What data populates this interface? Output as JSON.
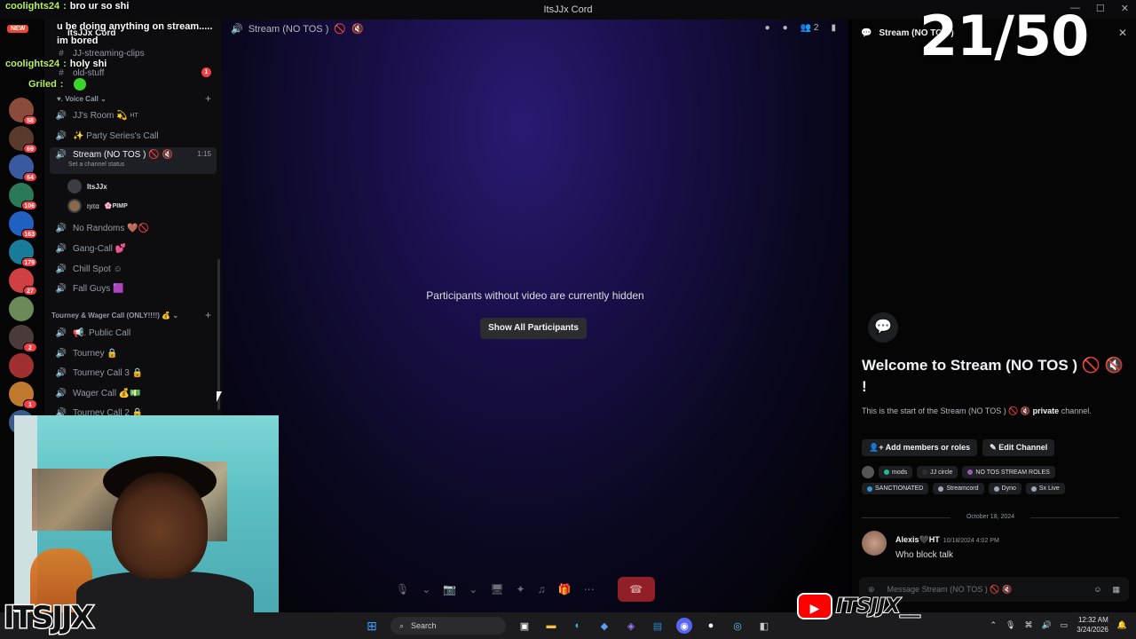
{
  "window": {
    "title": "ItsJJx Cord"
  },
  "chat_overlay": [
    {
      "name": "coolights24",
      "sep": ":",
      "message": "bro ur so shi"
    },
    {
      "name": "",
      "sep": "",
      "message": "u be doing anything on stream....."
    },
    {
      "name": "",
      "sep": "",
      "message": "im bored"
    },
    {
      "name": "coolights24",
      "sep": ":",
      "message": "holy shi"
    },
    {
      "name": "Griled",
      "sep": ":",
      "message": ""
    }
  ],
  "new_tag": "NEW",
  "server": {
    "name": "ItsJJx Cord",
    "badges": [
      "58",
      "69",
      "64",
      "106",
      "163",
      "179",
      "27",
      "2",
      "1"
    ]
  },
  "sidebar": {
    "top_channels": [
      "JJ-streaming-clips",
      "old-stuff"
    ],
    "unread_count": "1",
    "voice_category": "Voice Call",
    "voice_channels": [
      {
        "label": "JJ's Room 💫",
        "suffix": "HT"
      },
      {
        "label": "✨ Party Series's Call",
        "suffix": ""
      }
    ],
    "active_channel": {
      "label": "Stream (NO TOS )",
      "time": "1:15",
      "status": "Set a channel status"
    },
    "voice_users": [
      {
        "name": "ItsJJx",
        "tag": ""
      },
      {
        "name": "ηιτα",
        "tag": "🌸PIMP"
      }
    ],
    "more_channels": [
      {
        "label": "No Randoms 🤎🚫"
      },
      {
        "label": "Gang-Call 💕"
      },
      {
        "label": "Chill Spot ☺"
      },
      {
        "label": "Fall Guys 🟪"
      }
    ],
    "tourney_category": "Tourney & Wager Call (ONLY!!!!) 💰",
    "tourney_channels": [
      {
        "label": "📢. Public Call"
      },
      {
        "label": "Tourney 🔒"
      },
      {
        "label": "Tourney Call 3 🔒"
      },
      {
        "label": "Wager Call 💰💵"
      },
      {
        "label": "Tourney Call 2 🔒"
      }
    ]
  },
  "stage": {
    "channel_title": "Stream (NO TOS )",
    "participant_count": "2",
    "hidden_message": "Participants without video are currently hidden",
    "show_all_label": "Show All Participants"
  },
  "counter": "21/50",
  "panel": {
    "title": "Stream (NO TOS )",
    "welcome": "Welcome to Stream (NO TOS ) 🚫 🔇 !",
    "desc_prefix": "This is the start of the Stream (NO TOS ) 🚫 🔇",
    "desc_private": "private",
    "desc_suffix": "channel.",
    "add_members_label": "Add members or roles",
    "edit_channel_label": "Edit Channel",
    "roles": [
      {
        "name": "mods",
        "color": "#1abc9c"
      },
      {
        "name": "JJ circle",
        "color": "#2b2d31"
      },
      {
        "name": "NO TOS STREAM ROLES",
        "color": "#9b59b6"
      },
      {
        "name": "SANCTIONATED",
        "color": "#3498db"
      },
      {
        "name": "Streamcord",
        "color": "#99aab5"
      },
      {
        "name": "Dyno",
        "color": "#99aab5"
      },
      {
        "name": "Sx Live",
        "color": "#99aab5"
      }
    ],
    "date_separator": "October 18, 2024",
    "message": {
      "author": "Alexis🖤HT",
      "timestamp": "10/18/2024 4:02 PM",
      "text": "Who block talk"
    },
    "composer_placeholder": "Message Stream (NO TOS ) 🚫 🔇"
  },
  "taskbar": {
    "search_label": "Search",
    "time": "12:32 AM",
    "date": "3/24/2026"
  },
  "logos": {
    "left": "ITSJJX",
    "right": "ITSJJX__"
  }
}
